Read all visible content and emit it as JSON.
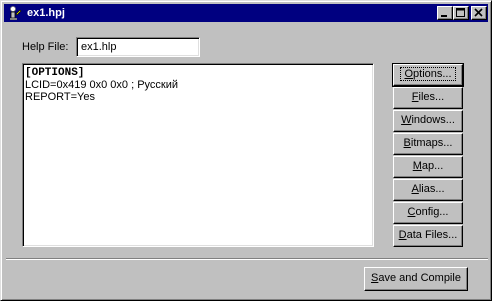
{
  "window": {
    "title": "ex1.hpj",
    "icon": "help-project-icon"
  },
  "form": {
    "help_file_label": "Help File:",
    "help_file_value": "ex1.hlp"
  },
  "editor": {
    "lines": [
      "[OPTIONS]",
      "LCID=0x419 0x0 0x0 ; Русский",
      "REPORT=Yes"
    ]
  },
  "buttons": {
    "options": {
      "pre": "",
      "u": "O",
      "post": "ptions..."
    },
    "files": {
      "pre": "",
      "u": "F",
      "post": "iles..."
    },
    "windows": {
      "pre": "",
      "u": "W",
      "post": "indows..."
    },
    "bitmaps": {
      "pre": "",
      "u": "B",
      "post": "itmaps..."
    },
    "map": {
      "pre": "",
      "u": "M",
      "post": "ap..."
    },
    "alias": {
      "pre": "",
      "u": "A",
      "post": "lias..."
    },
    "config": {
      "pre": "",
      "u": "C",
      "post": "onfig..."
    },
    "data_files": {
      "pre": "",
      "u": "D",
      "post": "ata Files..."
    },
    "save": {
      "pre": "",
      "u": "S",
      "post": "ave and Compile"
    }
  }
}
